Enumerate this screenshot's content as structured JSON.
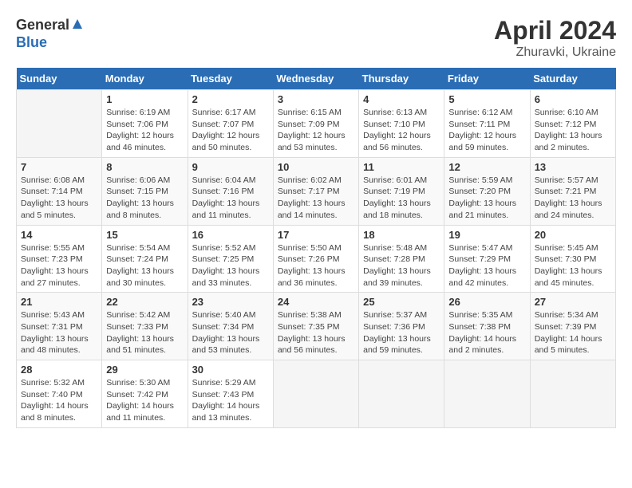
{
  "header": {
    "logo_general": "General",
    "logo_blue": "Blue",
    "title": "April 2024",
    "location": "Zhuravki, Ukraine"
  },
  "calendar": {
    "days_of_week": [
      "Sunday",
      "Monday",
      "Tuesday",
      "Wednesday",
      "Thursday",
      "Friday",
      "Saturday"
    ],
    "weeks": [
      [
        {
          "day": "",
          "info": ""
        },
        {
          "day": "1",
          "info": "Sunrise: 6:19 AM\nSunset: 7:06 PM\nDaylight: 12 hours\nand 46 minutes."
        },
        {
          "day": "2",
          "info": "Sunrise: 6:17 AM\nSunset: 7:07 PM\nDaylight: 12 hours\nand 50 minutes."
        },
        {
          "day": "3",
          "info": "Sunrise: 6:15 AM\nSunset: 7:09 PM\nDaylight: 12 hours\nand 53 minutes."
        },
        {
          "day": "4",
          "info": "Sunrise: 6:13 AM\nSunset: 7:10 PM\nDaylight: 12 hours\nand 56 minutes."
        },
        {
          "day": "5",
          "info": "Sunrise: 6:12 AM\nSunset: 7:11 PM\nDaylight: 12 hours\nand 59 minutes."
        },
        {
          "day": "6",
          "info": "Sunrise: 6:10 AM\nSunset: 7:12 PM\nDaylight: 13 hours\nand 2 minutes."
        }
      ],
      [
        {
          "day": "7",
          "info": "Sunrise: 6:08 AM\nSunset: 7:14 PM\nDaylight: 13 hours\nand 5 minutes."
        },
        {
          "day": "8",
          "info": "Sunrise: 6:06 AM\nSunset: 7:15 PM\nDaylight: 13 hours\nand 8 minutes."
        },
        {
          "day": "9",
          "info": "Sunrise: 6:04 AM\nSunset: 7:16 PM\nDaylight: 13 hours\nand 11 minutes."
        },
        {
          "day": "10",
          "info": "Sunrise: 6:02 AM\nSunset: 7:17 PM\nDaylight: 13 hours\nand 14 minutes."
        },
        {
          "day": "11",
          "info": "Sunrise: 6:01 AM\nSunset: 7:19 PM\nDaylight: 13 hours\nand 18 minutes."
        },
        {
          "day": "12",
          "info": "Sunrise: 5:59 AM\nSunset: 7:20 PM\nDaylight: 13 hours\nand 21 minutes."
        },
        {
          "day": "13",
          "info": "Sunrise: 5:57 AM\nSunset: 7:21 PM\nDaylight: 13 hours\nand 24 minutes."
        }
      ],
      [
        {
          "day": "14",
          "info": "Sunrise: 5:55 AM\nSunset: 7:23 PM\nDaylight: 13 hours\nand 27 minutes."
        },
        {
          "day": "15",
          "info": "Sunrise: 5:54 AM\nSunset: 7:24 PM\nDaylight: 13 hours\nand 30 minutes."
        },
        {
          "day": "16",
          "info": "Sunrise: 5:52 AM\nSunset: 7:25 PM\nDaylight: 13 hours\nand 33 minutes."
        },
        {
          "day": "17",
          "info": "Sunrise: 5:50 AM\nSunset: 7:26 PM\nDaylight: 13 hours\nand 36 minutes."
        },
        {
          "day": "18",
          "info": "Sunrise: 5:48 AM\nSunset: 7:28 PM\nDaylight: 13 hours\nand 39 minutes."
        },
        {
          "day": "19",
          "info": "Sunrise: 5:47 AM\nSunset: 7:29 PM\nDaylight: 13 hours\nand 42 minutes."
        },
        {
          "day": "20",
          "info": "Sunrise: 5:45 AM\nSunset: 7:30 PM\nDaylight: 13 hours\nand 45 minutes."
        }
      ],
      [
        {
          "day": "21",
          "info": "Sunrise: 5:43 AM\nSunset: 7:31 PM\nDaylight: 13 hours\nand 48 minutes."
        },
        {
          "day": "22",
          "info": "Sunrise: 5:42 AM\nSunset: 7:33 PM\nDaylight: 13 hours\nand 51 minutes."
        },
        {
          "day": "23",
          "info": "Sunrise: 5:40 AM\nSunset: 7:34 PM\nDaylight: 13 hours\nand 53 minutes."
        },
        {
          "day": "24",
          "info": "Sunrise: 5:38 AM\nSunset: 7:35 PM\nDaylight: 13 hours\nand 56 minutes."
        },
        {
          "day": "25",
          "info": "Sunrise: 5:37 AM\nSunset: 7:36 PM\nDaylight: 13 hours\nand 59 minutes."
        },
        {
          "day": "26",
          "info": "Sunrise: 5:35 AM\nSunset: 7:38 PM\nDaylight: 14 hours\nand 2 minutes."
        },
        {
          "day": "27",
          "info": "Sunrise: 5:34 AM\nSunset: 7:39 PM\nDaylight: 14 hours\nand 5 minutes."
        }
      ],
      [
        {
          "day": "28",
          "info": "Sunrise: 5:32 AM\nSunset: 7:40 PM\nDaylight: 14 hours\nand 8 minutes."
        },
        {
          "day": "29",
          "info": "Sunrise: 5:30 AM\nSunset: 7:42 PM\nDaylight: 14 hours\nand 11 minutes."
        },
        {
          "day": "30",
          "info": "Sunrise: 5:29 AM\nSunset: 7:43 PM\nDaylight: 14 hours\nand 13 minutes."
        },
        {
          "day": "",
          "info": ""
        },
        {
          "day": "",
          "info": ""
        },
        {
          "day": "",
          "info": ""
        },
        {
          "day": "",
          "info": ""
        }
      ]
    ]
  }
}
